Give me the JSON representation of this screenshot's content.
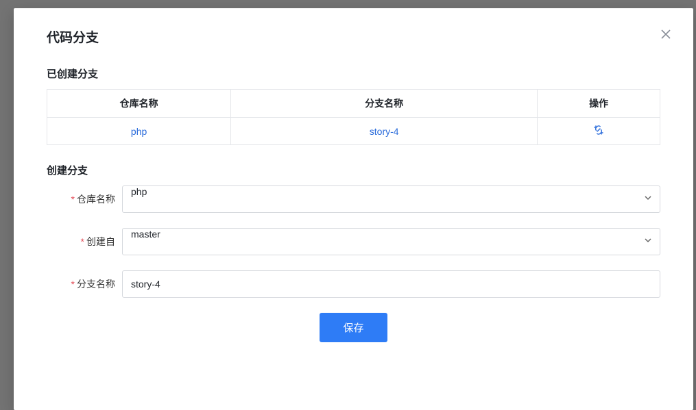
{
  "modal": {
    "title": "代码分支",
    "close_label": "关闭"
  },
  "existing": {
    "title": "已创建分支",
    "columns": {
      "repo": "仓库名称",
      "branch": "分支名称",
      "action": "操作"
    },
    "row": {
      "repo": "php",
      "branch": "story-4"
    }
  },
  "create": {
    "title": "创建分支",
    "repo_label": "仓库名称",
    "repo_value": "php",
    "from_label": "创建自",
    "from_value": "master",
    "branch_label": "分支名称",
    "branch_value": "story-4"
  },
  "actions": {
    "save": "保存"
  }
}
